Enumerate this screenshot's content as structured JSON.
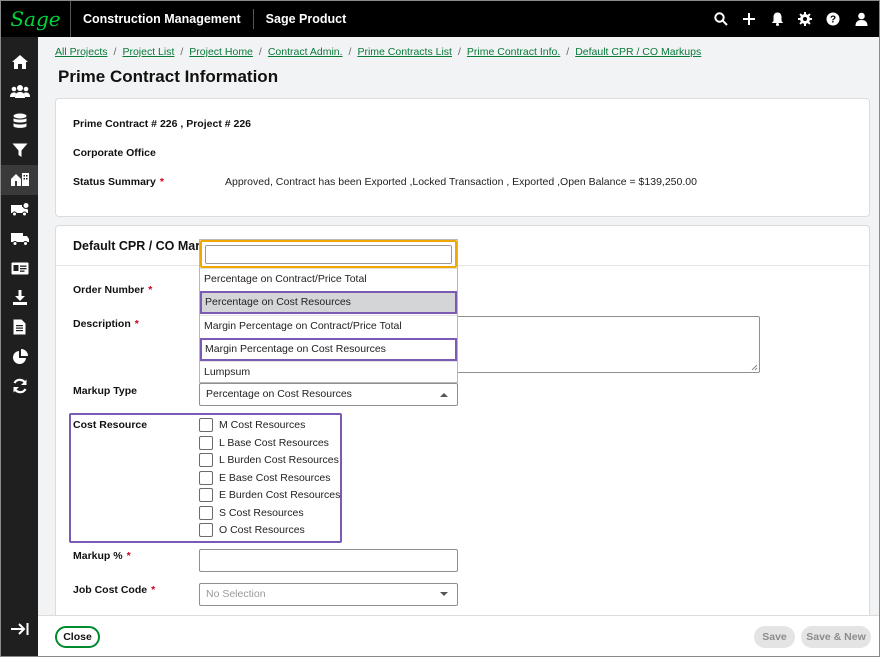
{
  "topbar": {
    "logo": "Sage",
    "app_title": "Construction Management",
    "product_title": "Sage Product",
    "icons": [
      "search-icon",
      "plus-icon",
      "bell-icon",
      "gear-icon",
      "help-icon",
      "user-icon"
    ]
  },
  "sidebar": {
    "icons": [
      "home-icon",
      "people-icon",
      "database-icon",
      "filter-icon",
      "projects-icon",
      "truck-clock-icon",
      "truck-icon",
      "id-card-icon",
      "download-icon",
      "document-icon",
      "pie-chart-icon",
      "refresh-icon"
    ],
    "collapse_icon": "expand-arrow-icon"
  },
  "breadcrumb": [
    "All Projects",
    "Project List",
    "Project Home",
    "Contract Admin.",
    "Prime Contracts List",
    "Prime Contract Info.",
    "Default CPR / CO Markups"
  ],
  "page_title": "Prime Contract Information",
  "info": {
    "contract_line": "Prime Contract # 226 , Project # 226",
    "office": "Corporate Office",
    "status_label": "Status Summary",
    "status_value": "Approved, Contract has been Exported ,Locked Transaction , Exported ,Open Balance = $139,250.00"
  },
  "section": {
    "title": "Default CPR / CO Markups",
    "order_number_label": "Order Number",
    "description_label": "Description",
    "markup_type_label": "Markup Type",
    "markup_type_value": "Percentage on Cost Resources",
    "cost_resource_label": "Cost Resource",
    "markup_pct_label": "Markup %",
    "job_cost_code_label": "Job Cost Code",
    "job_cost_code_placeholder": "No Selection",
    "required_mark": "*"
  },
  "dropdown": {
    "search_value": "",
    "options": [
      "Percentage on Contract/Price Total",
      "Percentage on Cost Resources",
      "Margin Percentage on Contract/Price Total",
      "Margin Percentage on Cost Resources",
      "Lumpsum"
    ],
    "selected": "Percentage on Cost Resources"
  },
  "cost_resources": [
    "M Cost Resources",
    "L Base Cost Resources",
    "L Burden Cost Resources",
    "E Base Cost Resources",
    "E Burden Cost Resources",
    "S Cost Resources",
    "O Cost Resources"
  ],
  "footer": {
    "close": "Close",
    "save": "Save",
    "save_new": "Save & New"
  },
  "colors": {
    "brand_green": "#00d639",
    "link_green": "#0a7a3a",
    "focus_orange": "#f0a800",
    "highlight_purple": "#7b5ab4",
    "required_red": "#d4001a"
  }
}
